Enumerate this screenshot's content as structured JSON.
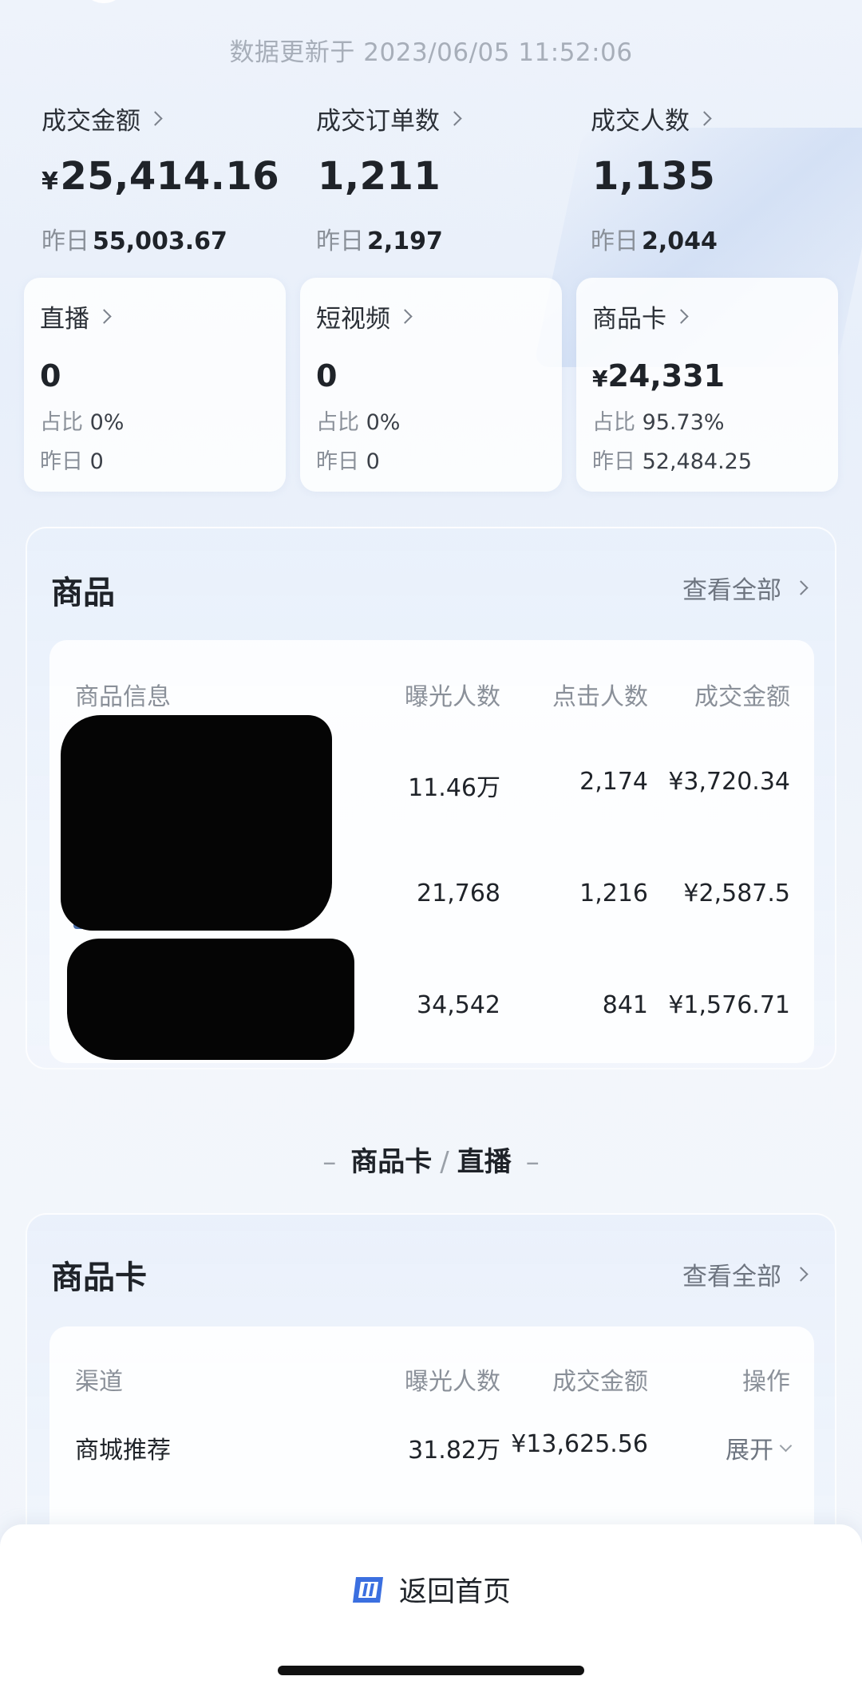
{
  "header": {
    "update_time": "数据更新于 2023/06/05 11:52:06"
  },
  "summary": [
    {
      "label": "成交金额",
      "currency": "¥",
      "value": "25,414.16",
      "yesterday_label": "昨日",
      "yesterday": "55,003.67"
    },
    {
      "label": "成交订单数",
      "currency": "",
      "value": "1,211",
      "yesterday_label": "昨日",
      "yesterday": "2,197"
    },
    {
      "label": "成交人数",
      "currency": "",
      "value": "1,135",
      "yesterday_label": "昨日",
      "yesterday": "2,044"
    }
  ],
  "channels": [
    {
      "label": "直播",
      "currency": "",
      "value": "0",
      "share_label": "占比",
      "share": "0%",
      "yesterday_label": "昨日",
      "yesterday": "0"
    },
    {
      "label": "短视频",
      "currency": "",
      "value": "0",
      "share_label": "占比",
      "share": "0%",
      "yesterday_label": "昨日",
      "yesterday": "0"
    },
    {
      "label": "商品卡",
      "currency": "¥",
      "value": "24,331",
      "share_label": "占比",
      "share": "95.73%",
      "yesterday_label": "昨日",
      "yesterday": "52,484.25"
    }
  ],
  "products": {
    "title": "商品",
    "view_all": "查看全部",
    "columns": [
      "商品信息",
      "曝光人数",
      "点击人数",
      "成交金额"
    ],
    "rows": [
      {
        "exposure": "11.46万",
        "clicks": "2,174",
        "amount": "¥3,720.34"
      },
      {
        "exposure": "21,768",
        "clicks": "1,216",
        "amount": "¥2,587.5"
      },
      {
        "exposure": "34,542",
        "clicks": "841",
        "amount": "¥1,576.71"
      }
    ]
  },
  "switcher": {
    "dash": "–",
    "left": "商品卡",
    "sep": "/",
    "right": "直播"
  },
  "card_section": {
    "title": "商品卡",
    "view_all": "查看全部",
    "columns": [
      "渠道",
      "曝光人数",
      "成交金额",
      "操作"
    ],
    "rows": [
      {
        "channel": "商城推荐",
        "exposure": "31.82万",
        "amount": "¥13,625.56",
        "action": "展开"
      }
    ]
  },
  "footer": {
    "home_label": "返回首页",
    "logo_icon": "douyin-shop-logo-icon",
    "accent": "#3b6fe0"
  }
}
